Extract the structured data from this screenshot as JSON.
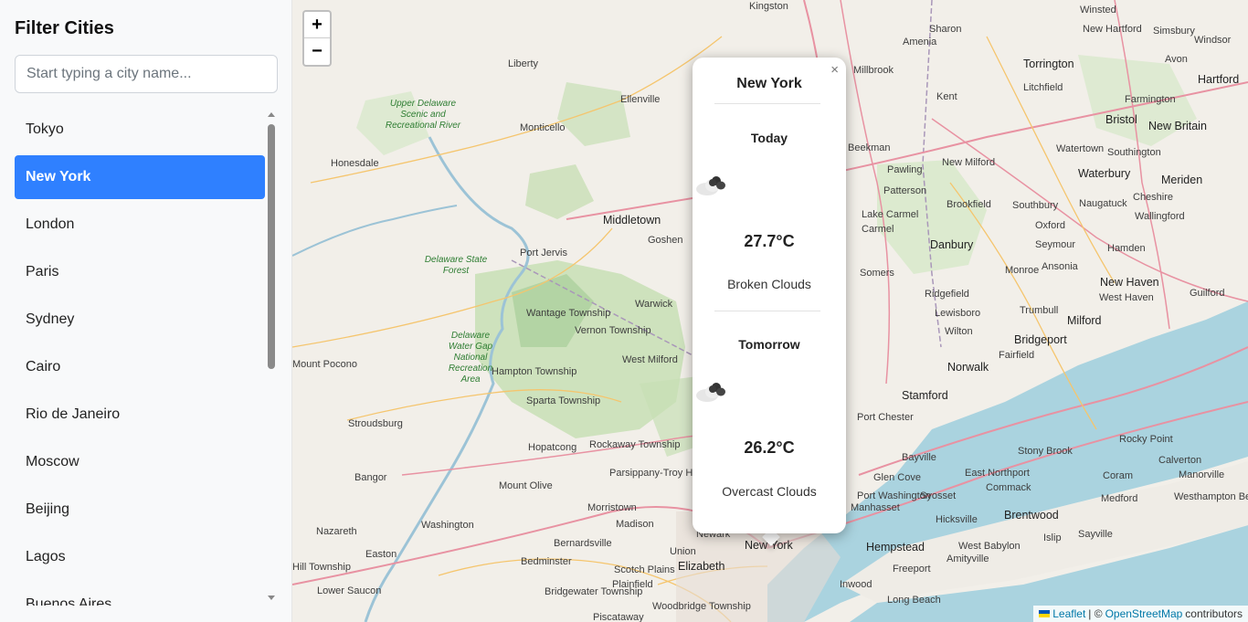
{
  "sidebar": {
    "title": "Filter Cities",
    "search_placeholder": "Start typing a city name...",
    "cities": [
      "Tokyo",
      "New York",
      "London",
      "Paris",
      "Sydney",
      "Cairo",
      "Rio de Janeiro",
      "Moscow",
      "Beijing",
      "Lagos",
      "Buenos Aires"
    ],
    "selected": "New York"
  },
  "map": {
    "zoom_in": "+",
    "zoom_out": "−",
    "attribution": {
      "leaflet": "Leaflet",
      "separator": "| ©",
      "osm": "OpenStreetMap",
      "suffix": "contributors"
    },
    "place_labels": [
      "Kingston",
      "Winsted",
      "New Hartford",
      "Simsbury",
      "Sharon",
      "Amenia",
      "Windsor",
      "Torrington",
      "Avon",
      "Hartford",
      "Liberty",
      "Millbrook",
      "Litchfield",
      "Farmington",
      "Kent",
      "Ellenville",
      "Monticello",
      "Bristol",
      "New Britain",
      "Honesdale",
      "Beekman",
      "Pawling",
      "New Milford",
      "Watertown",
      "Southington",
      "Waterbury",
      "Meriden",
      "Patterson",
      "Brookfield",
      "Southbury",
      "Naugatuck",
      "Cheshire",
      "Middletown",
      "Lake Carmel",
      "Oxford",
      "Wallingford",
      "Goshen",
      "Carmel",
      "Danbury",
      "Seymour",
      "Hamden",
      "Port Jervis",
      "Ansonia",
      "Somers",
      "Monroe",
      "New Haven",
      "West Haven",
      "Guilford",
      "Warwick",
      "Ridgefield",
      "Wantage Township",
      "Vernon Township",
      "Trumbull",
      "Milford",
      "Lewisboro",
      "Wilton",
      "Bridgeport",
      "Fairfield",
      "West Milford",
      "Mount Pocono",
      "Norwalk",
      "Hampton Township",
      "Sparta Township",
      "Stamford",
      "Stroudsburg",
      "Port Chester",
      "Hopatcong",
      "Rockaway Township",
      "Bayville",
      "Stony Brook",
      "Rocky Point",
      "Bangor",
      "Glen Cove",
      "East Northport",
      "Coram",
      "Calverton",
      "Manorville",
      "Mount Olive",
      "Parsippany-Troy Hills",
      "Commack",
      "Port Washington",
      "Syosset",
      "Medford",
      "Westhampton Beach",
      "Morristown",
      "Manhasset",
      "Hicksville",
      "Brentwood",
      "Washington",
      "Nazareth",
      "Bernardsville",
      "Madison",
      "Hempstead",
      "West Babylon",
      "Islip",
      "Sayville",
      "Easton",
      "Bedminster",
      "Union",
      "Newark",
      "New York",
      "Amityville",
      "Scotch Plains",
      "Elizabeth",
      "Freeport",
      "Plainfield",
      "Inwood",
      "Bridgewater Township",
      "Long Beach",
      "Woodbridge Township",
      "Piscataway",
      "Lower Saucon",
      "Hill Township"
    ],
    "park_labels": [
      "Upper Delaware Scenic and Recreational River",
      "Delaware State Forest",
      "Delaware Water Gap National Recreation Area"
    ]
  },
  "popup": {
    "close": "×",
    "city": "New York",
    "forecast": [
      {
        "day": "Today",
        "temp": "27.7°C",
        "description": "Broken Clouds",
        "icon": "broken-clouds-icon"
      },
      {
        "day": "Tomorrow",
        "temp": "26.2°C",
        "description": "Overcast Clouds",
        "icon": "overcast-clouds-icon"
      }
    ]
  },
  "colors": {
    "accent": "#2f80ff",
    "water": "#aad3df",
    "forest": "#add19e",
    "road_major": "#e892a2"
  }
}
